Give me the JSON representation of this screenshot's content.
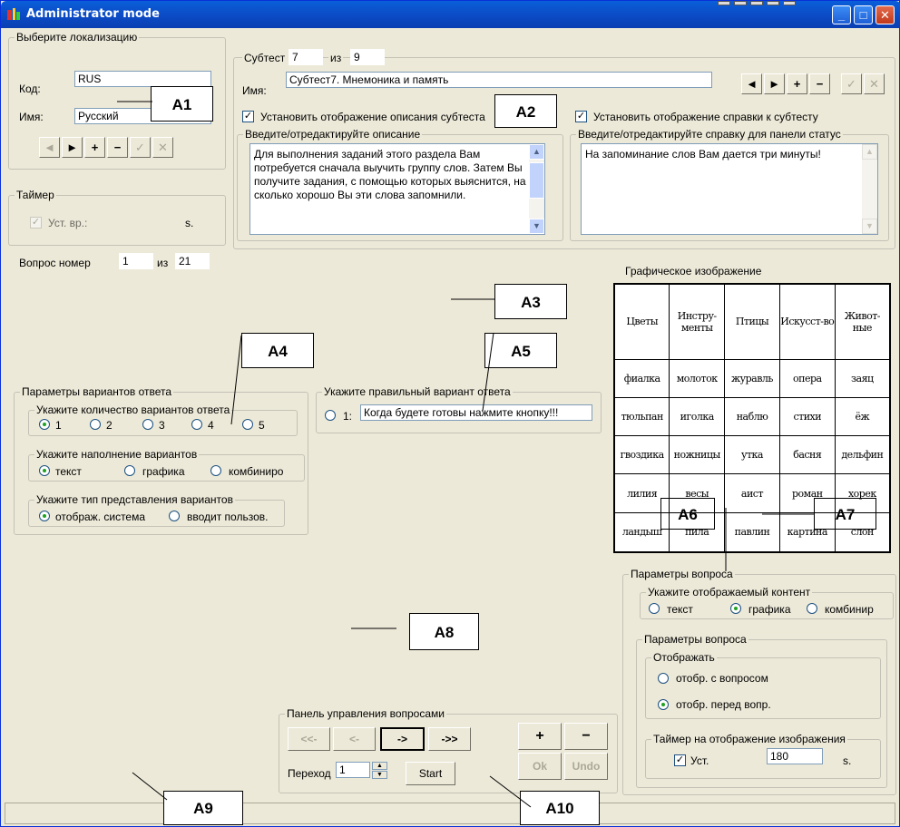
{
  "window": {
    "title": "Administrator mode"
  },
  "localization": {
    "legend": "Выберите локализацию",
    "code_label": "Код:",
    "code_value": "RUS",
    "name_label": "Имя:",
    "name_value": "Русский",
    "nav": [
      "◄",
      "►",
      "+",
      "−",
      "✓",
      "✕"
    ]
  },
  "timer": {
    "legend": "Таймер",
    "set_label": "Уст. вр.:",
    "unit": "s."
  },
  "question_num": {
    "label": "Вопрос номер",
    "value": "1",
    "of_label": "из",
    "total": "21"
  },
  "subtest": {
    "label": "Субтест №",
    "number": "7",
    "of_label": "из",
    "total": "9",
    "name_label": "Имя:",
    "name_value": "Субтест7. Мнемоника и память",
    "show_description_label": "Установить отображение описания субтеста",
    "show_help_label": "Установить отображение справки к субтесту",
    "description_legend": "Введите/отредактируйте описание",
    "description_text": "Для выполнения заданий этого раздела Вам потребуется сначала выучить группу слов. Затем Вы получите задания, с помощью которых выяснится, на сколько хорошо Вы эти слова запомнили.",
    "help_legend": "Введите/отредактируйте справку для панели статус",
    "help_text": "На запоминание слов Вам дается три минуты!",
    "nav": [
      "◄",
      "►",
      "+",
      "−",
      "✓",
      "✕"
    ]
  },
  "graphic": {
    "title": "Графическое изображение",
    "rows": [
      [
        "Цветы",
        "Инстру-менты",
        "Птицы",
        "Искусст-во",
        "Живот-ные"
      ],
      [
        "фиалка",
        "молоток",
        "журавль",
        "опера",
        "заяц"
      ],
      [
        "тюльпан",
        "иголка",
        "наблю",
        "стихи",
        "ёж"
      ],
      [
        "гвоздика",
        "ножницы",
        "утка",
        "басня",
        "дельфин"
      ],
      [
        "лилия",
        "весы",
        "аист",
        "роман",
        "хорек"
      ],
      [
        "ландыш",
        "пила",
        "павлин",
        "картина",
        "слон"
      ]
    ]
  },
  "answer_params": {
    "legend": "Параметры вариантов ответа",
    "count_legend": "Укажите количество вариантов ответа",
    "count_options": [
      "1",
      "2",
      "3",
      "4",
      "5"
    ],
    "fill_legend": "Укажите наполнение вариантов",
    "fill_options": [
      "текст",
      "графика",
      "комбиниро"
    ],
    "type_legend": "Укажите тип представления вариантов",
    "type_options": [
      "отображ. система",
      "вводит пользов."
    ]
  },
  "correct_answer": {
    "legend": "Укажите правильный вариант ответа",
    "option_label": "1:",
    "option_value": "Когда будете готовы нажмите кнопку!!!"
  },
  "question_params": {
    "legend": "Параметры вопроса",
    "content_legend": "Укажите отображаемый контент",
    "content_options": [
      "текст",
      "графика",
      "комбинир"
    ],
    "inner_legend": "Параметры вопроса",
    "display_legend": "Отображать",
    "display_options": [
      "отобр. с вопросом",
      "отобр. перед вопр."
    ],
    "image_timer_legend": "Таймер на отображение изображения",
    "image_timer_set_label": "Уст.",
    "image_timer_value": "180",
    "image_timer_unit": "s."
  },
  "control_panel": {
    "legend": "Панель управления вопросами",
    "first_label": "<<-",
    "prev_label": "<-",
    "next_label": "->",
    "last_label": "->>",
    "goto_label": "Переход",
    "goto_value": "1",
    "start_label": "Start",
    "add_label": "+",
    "remove_label": "−",
    "ok_label": "Ok",
    "undo_label": "Undo"
  },
  "annotations": [
    "A1",
    "A2",
    "A3",
    "A4",
    "A5",
    "A6",
    "A7",
    "A8",
    "A9",
    "A10"
  ]
}
